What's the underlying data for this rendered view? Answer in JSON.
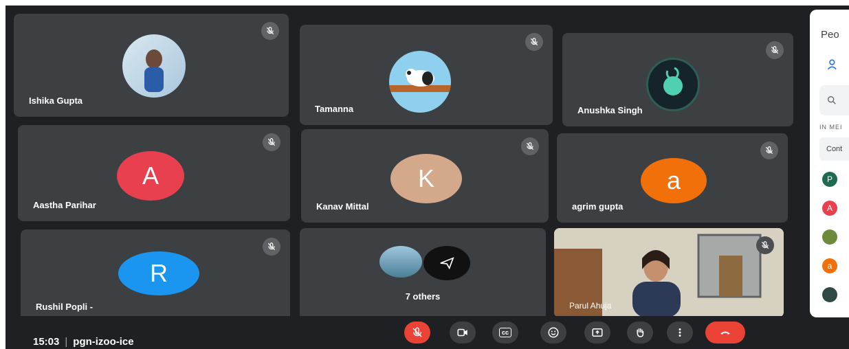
{
  "participants": [
    {
      "name": "Ishika Gupta"
    },
    {
      "name": "Tamanna"
    },
    {
      "name": "Anushka Singh"
    },
    {
      "name": "Aastha Parihar",
      "initial": "A",
      "color": "#e8404f"
    },
    {
      "name": "Kanav Mittal",
      "initial": "K",
      "color": "#d4a88a"
    },
    {
      "name": "agrim gupta",
      "initial": "a",
      "color": "#f2700a"
    },
    {
      "name": "Rushil Popli -",
      "initial": "R",
      "color": "#1a96f0"
    },
    {
      "name": "Parul Ahuja"
    }
  ],
  "others_tile": {
    "label": "7 others"
  },
  "meeting": {
    "time": "15:03",
    "code": "pgn-izoo-ice"
  },
  "controls": [
    {
      "icon": "mic-off-icon"
    },
    {
      "icon": "camera-icon"
    },
    {
      "icon": "captions-icon",
      "label": "cc"
    },
    {
      "icon": "emoji-icon"
    },
    {
      "icon": "present-icon"
    },
    {
      "icon": "raise-hand-icon"
    },
    {
      "icon": "more-options-icon"
    },
    {
      "icon": "end-call-icon"
    }
  ],
  "people_panel": {
    "title": "Peo",
    "section": "IN MEI",
    "contributors": "Cont",
    "list": [
      {
        "initial": "P",
        "color": "#1e6b52"
      },
      {
        "initial": "A",
        "color": "#e8404f"
      },
      {
        "initial": "",
        "color": "#6e8a3c"
      },
      {
        "initial": "a",
        "color": "#f2700a"
      },
      {
        "initial": "",
        "color": "#2f4a46"
      }
    ]
  },
  "colors": {
    "tile": "#3c4043",
    "background": "#1f2023",
    "end_call": "#ea4335",
    "mic_off": "#ea4335"
  }
}
